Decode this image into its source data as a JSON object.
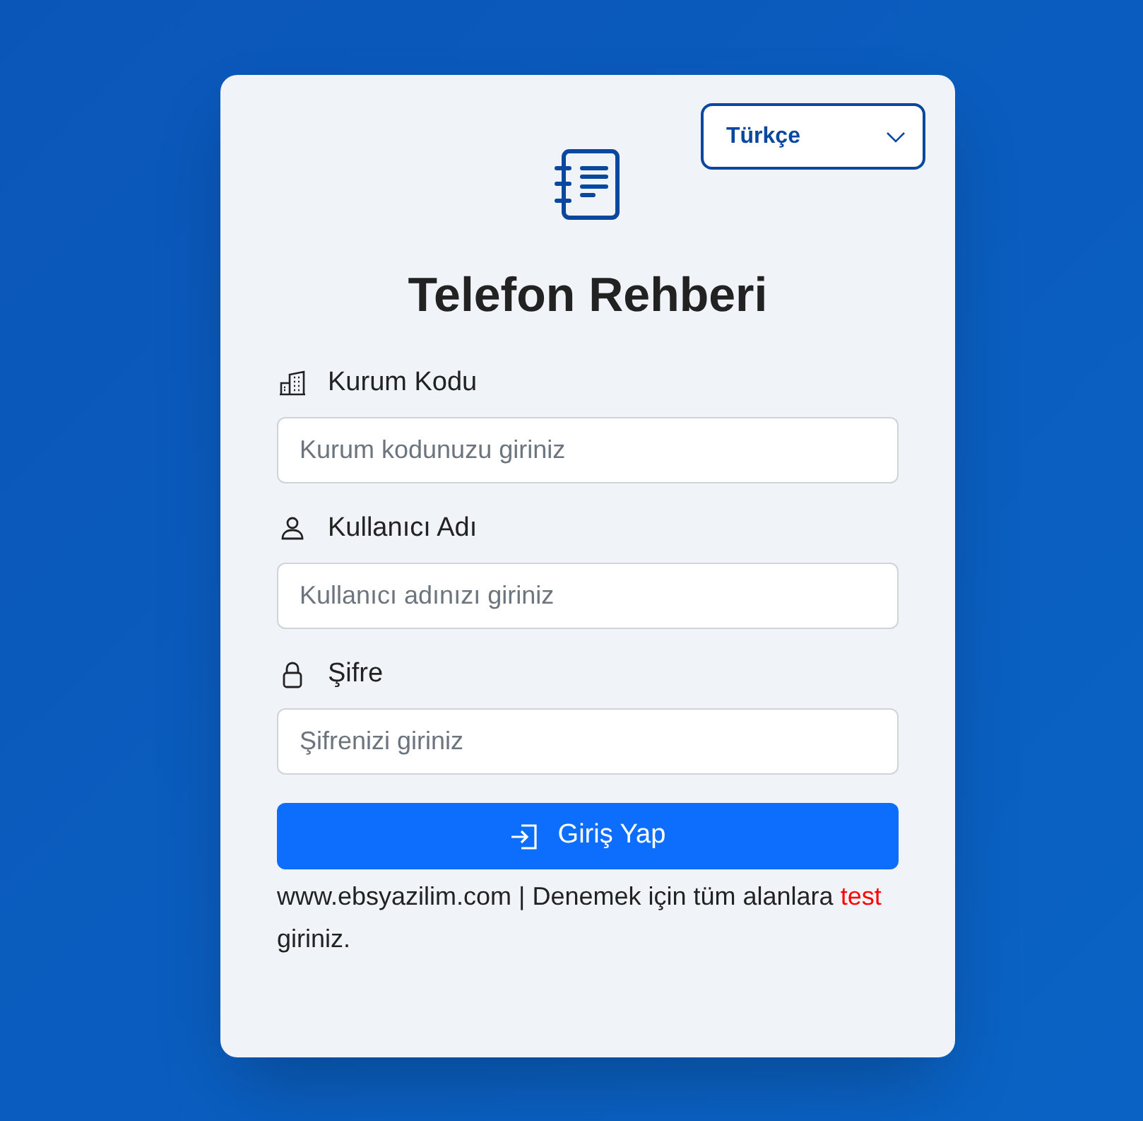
{
  "language_select": {
    "value": "Türkçe"
  },
  "title": "Telefon Rehberi",
  "fields": [
    {
      "kind": "building",
      "label": "Kurum Kodu",
      "placeholder": "Kurum kodunuzu giriniz"
    },
    {
      "kind": "person",
      "label": "Kullanıcı Adı",
      "placeholder": "Kullanıcı adınızı giriniz"
    },
    {
      "kind": "lock",
      "label": "Şifre",
      "placeholder": "Şifrenizi giriniz"
    }
  ],
  "login_button": "Giriş Yap",
  "note": [
    {
      "kind": "plain",
      "text": "www.ebsyazilim.com | Denemek için tüm alanlara"
    },
    {
      "kind": "highlight",
      "text": "test"
    },
    {
      "kind": "plain",
      "text": "giriniz."
    }
  ]
}
